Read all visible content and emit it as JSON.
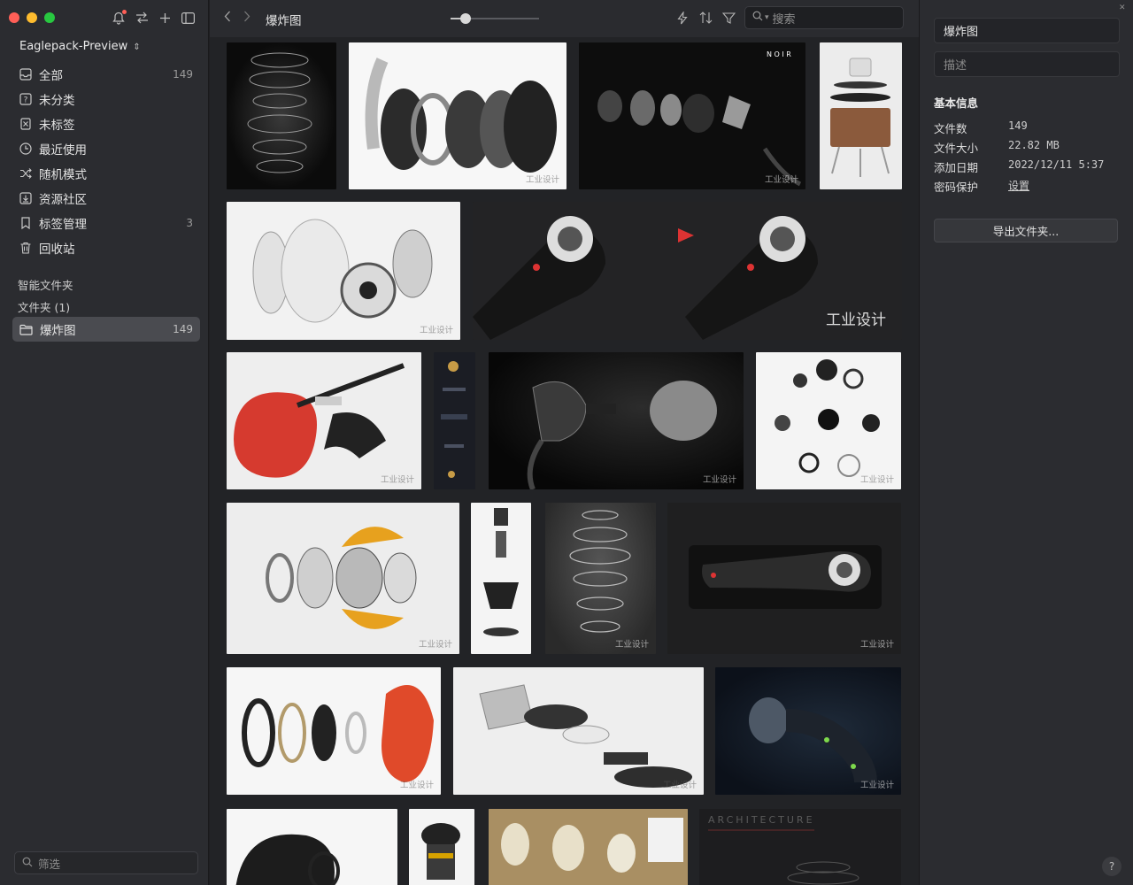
{
  "sidebar": {
    "library_name": "Eaglepack-Preview",
    "library_caret": "⌃",
    "items": [
      {
        "label": "全部",
        "count": "149",
        "icon": "inbox-icon"
      },
      {
        "label": "未分类",
        "count": "",
        "icon": "question-box-icon"
      },
      {
        "label": "未标签",
        "count": "",
        "icon": "untagged-icon"
      },
      {
        "label": "最近使用",
        "count": "",
        "icon": "clock-icon"
      },
      {
        "label": "随机模式",
        "count": "",
        "icon": "shuffle-icon"
      },
      {
        "label": "资源社区",
        "count": "",
        "icon": "download-box-icon"
      },
      {
        "label": "标签管理",
        "count": "3",
        "icon": "bookmark-icon"
      },
      {
        "label": "回收站",
        "count": "",
        "icon": "trash-icon"
      }
    ],
    "smart_folders_label": "智能文件夹",
    "folders_label": "文件夹 (1)",
    "active_folder": {
      "label": "爆炸图",
      "count": "149"
    },
    "filter_placeholder": "筛选"
  },
  "toolbar": {
    "title": "爆炸图",
    "search_placeholder": "搜索",
    "zoom_level": 0.17
  },
  "grid": {
    "watermark": "工业设计"
  },
  "inspector": {
    "title": "爆炸图",
    "description_placeholder": "描述",
    "section_title": "基本信息",
    "rows": [
      {
        "key": "文件数",
        "value": "149"
      },
      {
        "key": "文件大小",
        "value": "22.82 MB"
      },
      {
        "key": "添加日期",
        "value": "2022/12/11 5:37"
      },
      {
        "key": "密码保护",
        "value": "设置"
      }
    ],
    "export_label": "导出文件夹...",
    "help_label": "?"
  },
  "colors": {
    "sidebar_bg": "#2b2c30",
    "grid_bg": "#222326",
    "active_item": "#4a4b50",
    "traffic_red": "#ff5f57",
    "traffic_yellow": "#febc2e",
    "traffic_green": "#28c840"
  }
}
